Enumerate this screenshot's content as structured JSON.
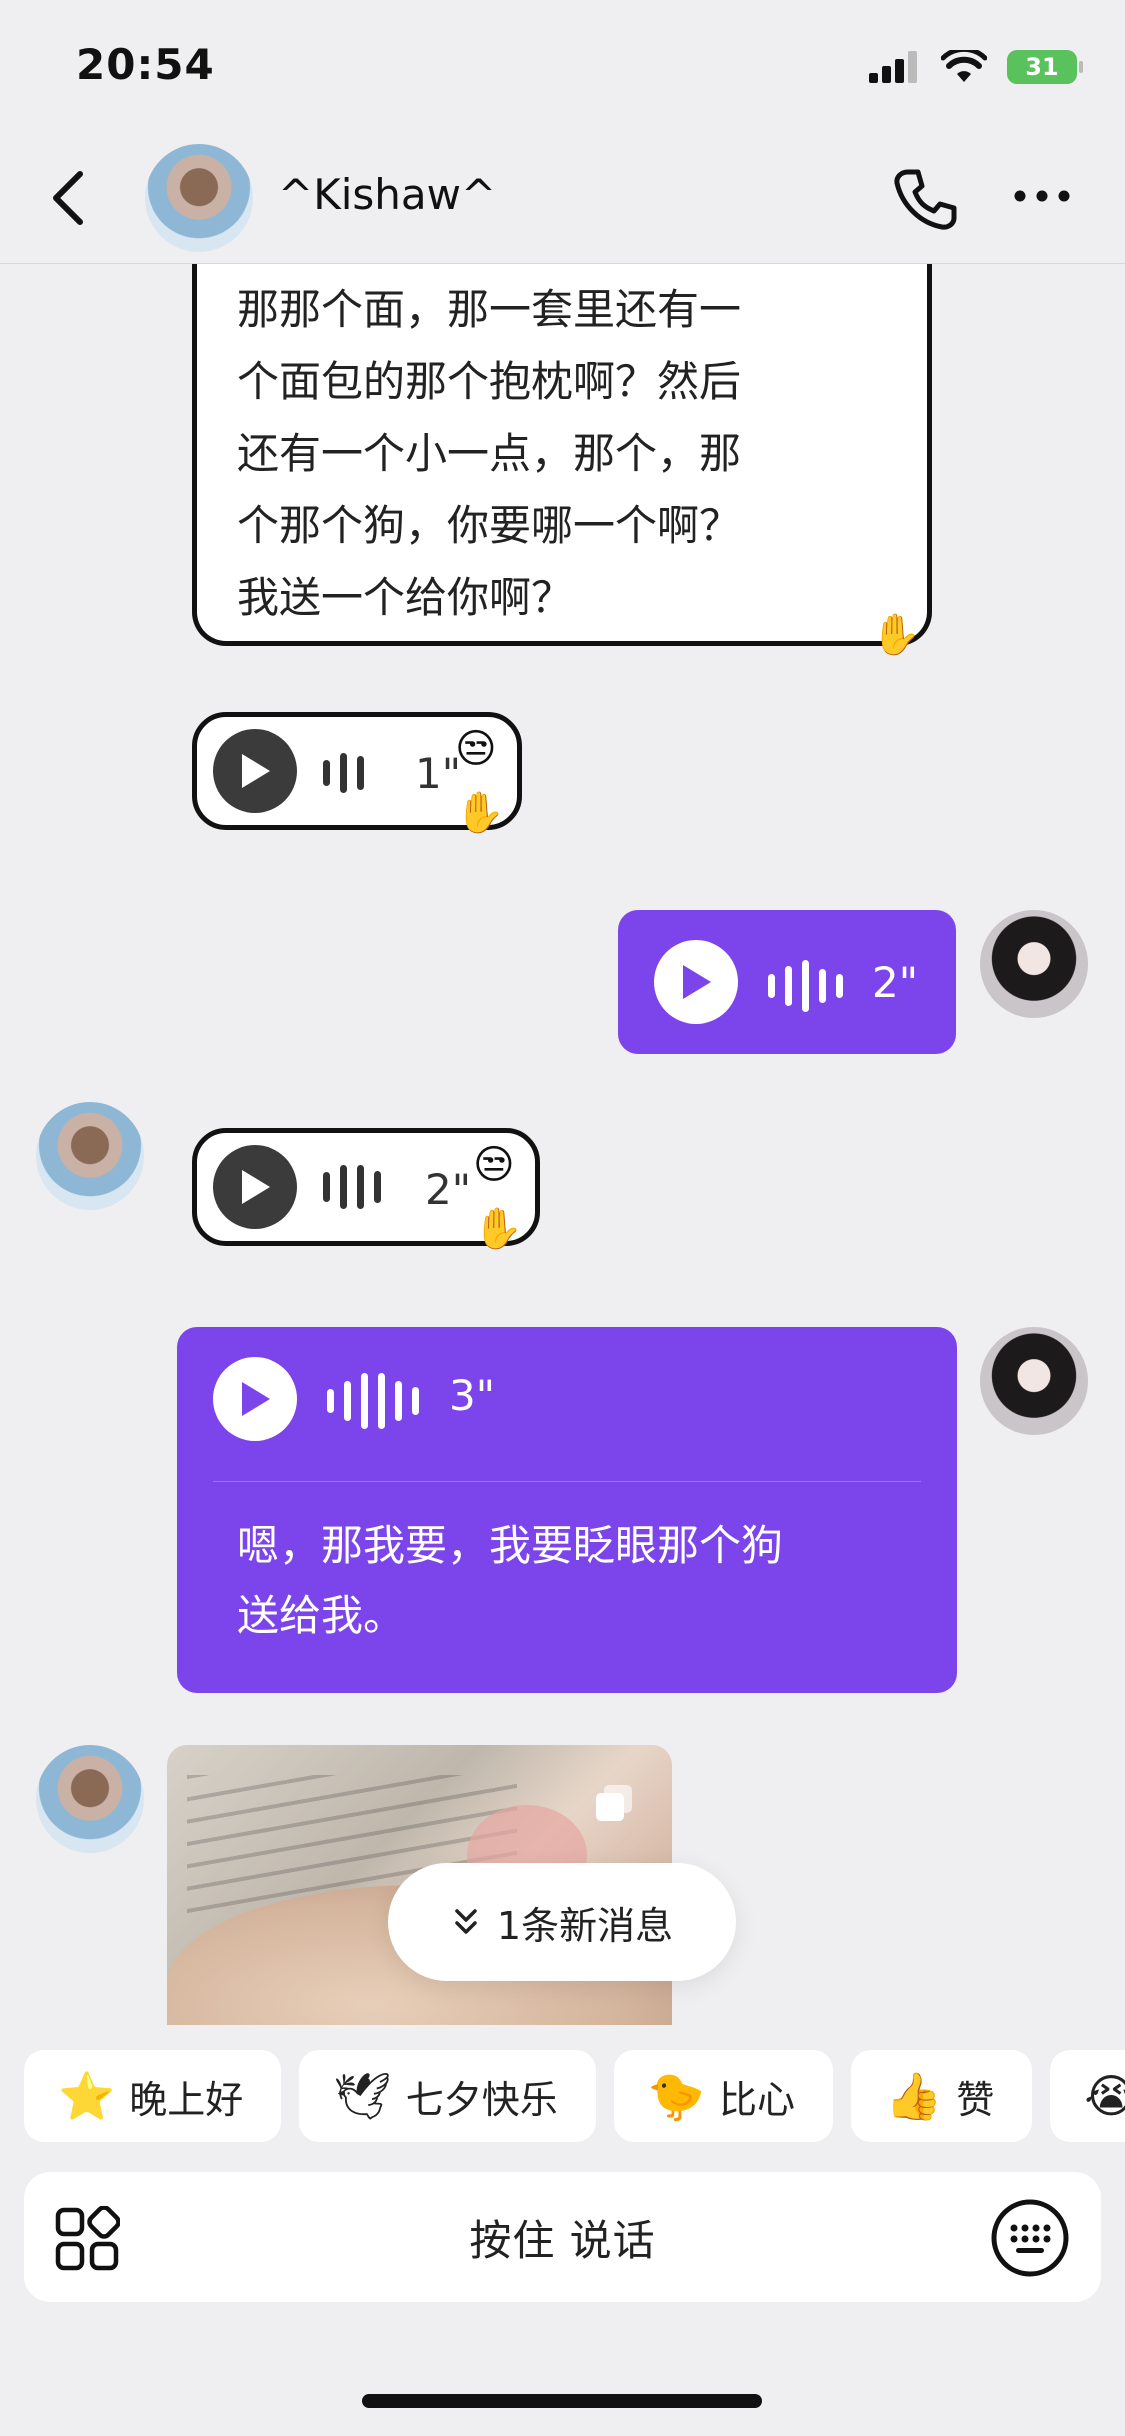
{
  "status_bar": {
    "time": "20:54",
    "battery": "31"
  },
  "header": {
    "name": "^Kishaw^"
  },
  "messages": {
    "text_bubble": {
      "lines": [
        "那那个面，那一套里还有一",
        "个面包的那个抱枕啊？然后",
        "还有一个小一点，那个，那",
        "个那个狗，你要哪一个啊？",
        "我送一个给你啊？"
      ]
    },
    "voice_1": {
      "duration": "1\""
    },
    "voice_2": {
      "duration": "2\""
    },
    "voice_3": {
      "duration": "2\""
    },
    "voice_4": {
      "duration": "3\"",
      "transcript": [
        "嗯，那我要，我要眨眼那个狗",
        "送给我。"
      ]
    }
  },
  "new_messages_pill": {
    "label": "1条新消息"
  },
  "quick_phrases": [
    {
      "emoji": "⭐",
      "label": "晚上好"
    },
    {
      "emoji": "🕊",
      "label": "七夕快乐"
    },
    {
      "emoji": "🐤",
      "label": "比心"
    },
    {
      "emoji": "👍",
      "label": "赞"
    },
    {
      "emoji": "😭",
      "label": ""
    }
  ],
  "input_bar": {
    "hold_to_talk": "按住 说话"
  },
  "colors": {
    "accent": "#7c45ec",
    "background": "#efeef0"
  }
}
